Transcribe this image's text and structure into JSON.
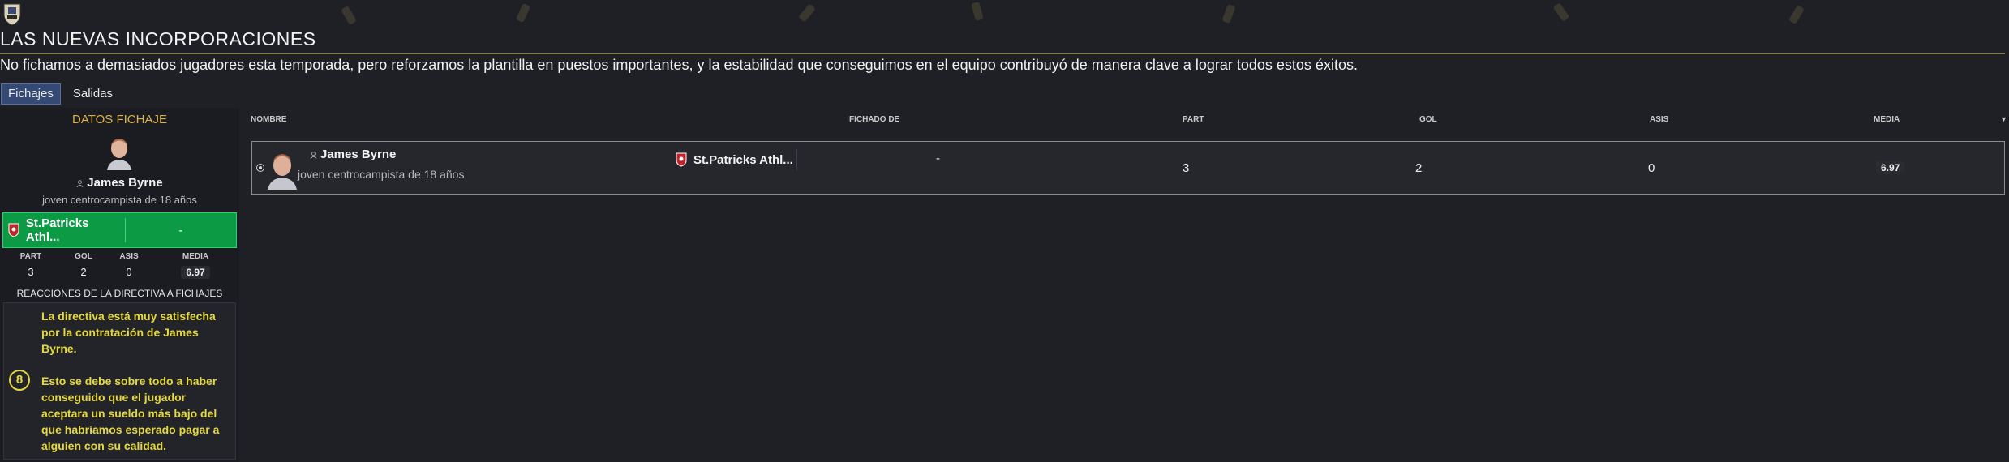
{
  "header": {
    "title": "LAS NUEVAS INCORPORACIONES",
    "subtitle": "No fichamos a demasiados jugadores esta temporada, pero reforzamos la plantilla en puestos importantes, y la estabilidad que conseguimos en el equipo contribuyó de manera clave a lograr todos estos éxitos."
  },
  "tabs": [
    {
      "label": "Fichajes",
      "active": true
    },
    {
      "label": "Salidas",
      "active": false
    }
  ],
  "left_panel": {
    "title": "DATOS FICHAJE",
    "player_name": "James Byrne",
    "player_desc": "joven centrocampista de 18 años",
    "club": "St.Patricks Athl...",
    "fee": "-",
    "stats": [
      {
        "label": "PART",
        "value": "3"
      },
      {
        "label": "GOL",
        "value": "2"
      },
      {
        "label": "ASIS",
        "value": "0"
      },
      {
        "label": "MEDIA",
        "value": "6.97"
      }
    ],
    "reactions_title": "REACCIONES DE LA DIRECTIVA A FICHAJES",
    "reaction_number": "8",
    "reaction_line1": "La directiva está muy satisfecha por la contratación de James Byrne.",
    "reaction_line2": "Esto se debe sobre todo a haber conseguido que el jugador aceptara un sueldo más bajo del que habríamos esperado pagar a alguien con su calidad."
  },
  "table": {
    "columns": [
      "NOMBRE",
      "FICHADO DE",
      "PART",
      "GOL",
      "ASIS",
      "MEDIA"
    ],
    "rows": [
      {
        "name": "James Byrne",
        "desc": "joven centrocampista de 18 años",
        "club": "St.Patricks Athl...",
        "fee": "-",
        "part": "3",
        "gol": "2",
        "asis": "0",
        "media": "6.97"
      }
    ]
  },
  "colors": {
    "background": "#1f2026",
    "accent_gold": "#d8b34a",
    "reaction_yellow": "#e4d83c",
    "transfer_green": "#0d9a45",
    "active_tab": "#344a74"
  },
  "icons": [
    "club-crest-icon",
    "person-icon",
    "club-badge-icon",
    "player-face-icon",
    "radio-icon",
    "sort-arrow-icon"
  ]
}
